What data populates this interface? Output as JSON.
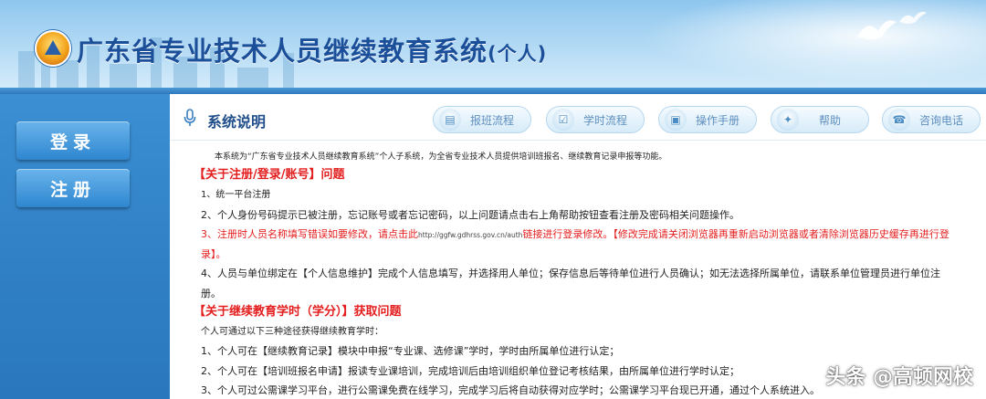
{
  "header": {
    "title": "广东省专业技术人员继续教育系统",
    "title_suffix": "(个人)"
  },
  "sidebar": {
    "login_label": "登录",
    "register_label": "注册"
  },
  "toolbar": {
    "section_title": "系统说明",
    "buttons": [
      {
        "label": "报班流程",
        "icon": "clipboard-icon"
      },
      {
        "label": "学时流程",
        "icon": "checklist-icon"
      },
      {
        "label": "操作手册",
        "icon": "manual-icon"
      },
      {
        "label": "帮助",
        "icon": "lightbulb-icon"
      },
      {
        "label": "咨询电话",
        "icon": "phone-list-icon"
      }
    ]
  },
  "content": {
    "intro": "本系统为“广东省专业技术人员继续教育系统”个人子系统，为全省专业技术人员提供培训班报名、继续教育记录申报等功能。",
    "section1_title": "【关于注册/登录/账号】问题",
    "s1_item1": "1、统一平台注册",
    "s1_item2": "2、个人身份号码提示已被注册，忘记账号或者忘记密码，以上问题请点击右上角帮助按钮查看注册及密码相关问题操作。",
    "s1_item3_a": "3、注册时人员名称填写错误如要修改，请点击此",
    "s1_item3_link": "http://ggfw.gdhrss.gov.cn/auth",
    "s1_item3_b": "链接进行登录修改。【修改完成请关闭浏览器再重新启动浏览器或者清除浏览器历史缓存再进行登",
    "s1_item3_c": "录】。",
    "s1_item4_a": "4、人员与单位绑定在【个人信息维护】完成个人信息填写，并选择用人单位；保存信息后等待单位进行人员确认；如无法选择所属单位，请联系单位管理员进行单位注",
    "s1_item4_b": "册。",
    "section2_title": "【关于继续教育学时（学分）】获取问题",
    "s2_intro": "个人可通过以下三种途径获得继续教育学时：",
    "s2_item1": "1、个人可在【继续教育记录】模块中申报“专业课、选修课”学时，学时由所属单位进行认定；",
    "s2_item2": "2、个人可在【培训班报名申请】报读专业课培训，完成培训后由培训组织单位登记考核结果，由所属单位进行学时认定；",
    "s2_item3": "3、个人可过公需课学习平台，进行公需课免费在线学习，完成学习后将自动获得对应学时；公需课学习平台现已开通，通过个人系统进入。"
  },
  "watermark": "头条 @高顿网校",
  "colors": {
    "title_blue": "#1c4f9a",
    "sidebar_blue": "#2f7fc4",
    "alert_red": "#e41e1e"
  }
}
